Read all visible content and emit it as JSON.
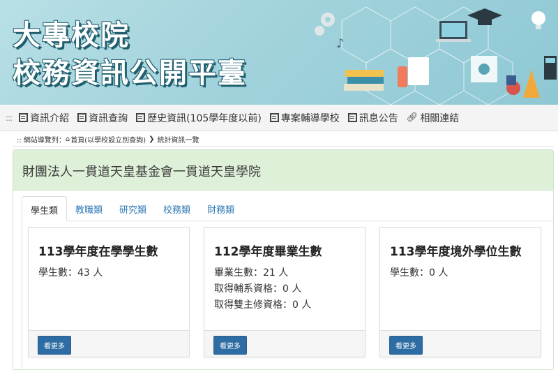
{
  "banner": {
    "title_line1": "大專校院",
    "title_line2": "校務資訊公開平臺",
    "colors": {
      "background": "#a4d4dd",
      "title_text": "#ffffff",
      "title_outline": "#1f5f6e"
    }
  },
  "nav": {
    "grip": ":::",
    "items": [
      {
        "label": "資訊介紹",
        "icon": "book-icon"
      },
      {
        "label": "資訊查詢",
        "icon": "list-icon"
      },
      {
        "label": "歷史資訊(105學年度以前)",
        "icon": "list-icon"
      },
      {
        "label": "專案輔導學校",
        "icon": "list-icon"
      },
      {
        "label": "訊息公告",
        "icon": "list-icon"
      },
      {
        "label": "相關連結",
        "icon": "link-icon"
      }
    ]
  },
  "breadcrumb": {
    "prefix": ":: 網站導覽列：",
    "home": "首頁(以學校設立別查詢)",
    "separator": "❯",
    "current": "統計資訊一覽"
  },
  "school": {
    "name": "財團法人一貫道天皇基金會一貫道天皇學院",
    "header_color": "#dff0d8"
  },
  "tabs": [
    {
      "label": "學生類",
      "active": true
    },
    {
      "label": "教職類",
      "active": false
    },
    {
      "label": "研究類",
      "active": false
    },
    {
      "label": "校務類",
      "active": false
    },
    {
      "label": "財務類",
      "active": false
    }
  ],
  "cards": [
    {
      "title": "113學年度在學學生數",
      "lines": [
        "學生數：43 人"
      ],
      "button": "看更多"
    },
    {
      "title": "112學年度畢業生數",
      "lines": [
        "畢業生數：21 人",
        "取得輔系資格：0 人",
        "取得雙主修資格：0 人"
      ],
      "button": "看更多"
    },
    {
      "title": "113學年度境外學位生數",
      "lines": [
        "學生數：0 人"
      ],
      "button": "看更多"
    }
  ],
  "colors": {
    "link": "#337ab7",
    "button": "#2e6da4"
  }
}
